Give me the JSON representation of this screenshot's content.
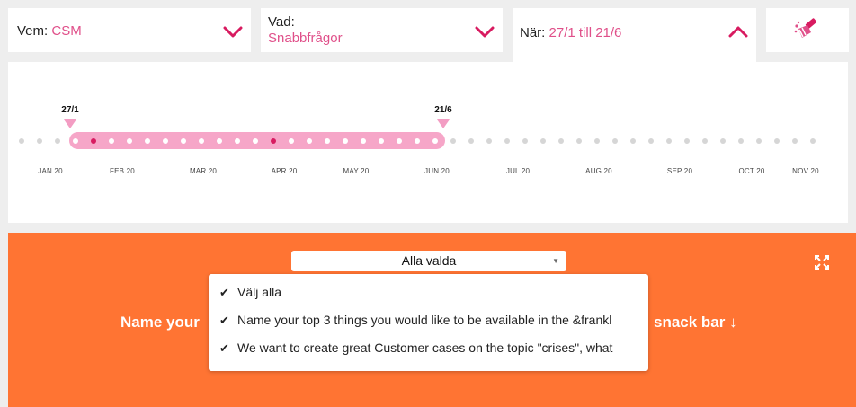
{
  "filters": {
    "vem": {
      "label": "Vem:",
      "value": "CSM"
    },
    "vad": {
      "label": "Vad:",
      "value": "Snabbfrågor"
    },
    "nar": {
      "label": "När:",
      "value": "27/1 till 21/6"
    }
  },
  "timeline": {
    "start_marker": "27/1",
    "end_marker": "21/6",
    "months": [
      "JAN 20",
      "FEB 20",
      "MAR 20",
      "APR 20",
      "MAY 20",
      "JUN 20",
      "JUL 20",
      "AUG 20",
      "SEP 20",
      "OCT 20",
      "NOV 20"
    ]
  },
  "question_select": {
    "value": "Alla valda",
    "options": [
      {
        "label": "Välj alla",
        "checked": true
      },
      {
        "label": "Name your top 3 things you would like to be available in the &frankl",
        "checked": true
      },
      {
        "label": "We want to create great Customer cases on the topic \"crises\", what",
        "checked": true
      }
    ]
  },
  "question_title": {
    "left": "Name your",
    "right": "snack bar ↓"
  },
  "icons": {
    "clear": "paint-brush-icon",
    "expand": "expand-icon"
  },
  "colors": {
    "accent": "#e0508a",
    "orange": "#ff7433",
    "range": "#f6a6c8",
    "active_dot": "#d81b60"
  }
}
